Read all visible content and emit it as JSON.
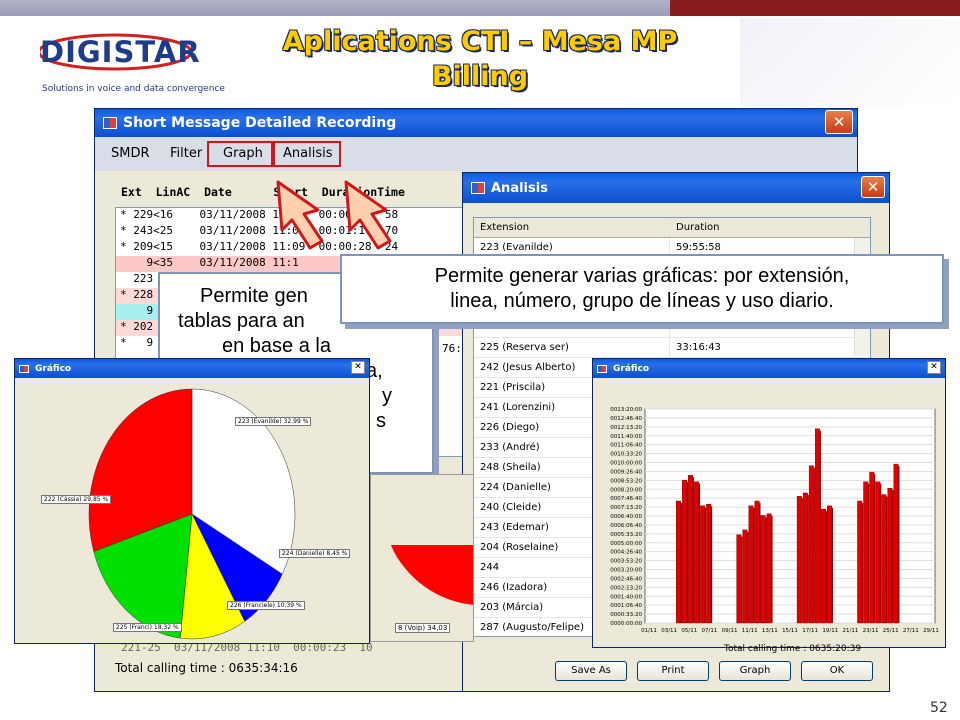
{
  "slide": {
    "title_line1": "Aplications CTI – Mesa MP",
    "title_line2": "Billing",
    "page_number": "52",
    "logo_text": "DIGISTAR",
    "logo_tagline": "Solutions in voice and data convergence"
  },
  "smdr_window": {
    "title": "Short Message Detailed Recording",
    "menu": [
      "SMDR",
      "Filter",
      "Graph",
      "Analisis"
    ],
    "header": "Ext  LinAC  Date      Start  DurationTime",
    "rows": [
      "* 229<16    03/11/2008 11:09  00:00:20  58",
      "* 243<25    03/11/2008 11:09  00:01:17  70",
      "* 209<15    03/11/2008 11:09  00:00:28  24",
      "    9<35    03/11/2008 11:1",
      "  223",
      "* 228",
      "    9",
      "* 202",
      "*   9"
    ],
    "footer_row": "221-25  03/11/2008 11:10  00:00:23  10",
    "total": "Total calling time : 0635:34:16"
  },
  "callout_left": {
    "lines": [
      "Permite gen",
      "tablas para an",
      "en base a la",
      "a,",
      "y",
      "s"
    ],
    "right_tail": "76:"
  },
  "callout_right": {
    "line1": "Permite generar varias gráficas: por extensión,",
    "line2": "linea, número,  grupo de líneas y uso diario."
  },
  "analisis_window": {
    "title": "Analisis",
    "columns": [
      "Extension",
      "Duration"
    ],
    "rows": [
      {
        "ext": "223 (Evanilde)",
        "dur": "59:55:58"
      },
      {
        "ext": "",
        "dur": ""
      },
      {
        "ext": "",
        "dur": ""
      },
      {
        "ext": "",
        "dur": ""
      },
      {
        "ext": "",
        "dur": ""
      },
      {
        "ext": "225 (Reserva ser)",
        "dur": "33:16:43"
      },
      {
        "ext": "242 (Jesus Alberto)",
        "dur": ""
      },
      {
        "ext": "221 (Priscila)",
        "dur": ""
      },
      {
        "ext": "241 (Lorenzini)",
        "dur": ""
      },
      {
        "ext": "226 (Diego)",
        "dur": ""
      },
      {
        "ext": "233 (André)",
        "dur": ""
      },
      {
        "ext": "248 (Sheila)",
        "dur": ""
      },
      {
        "ext": "224 (Danielle)",
        "dur": ""
      },
      {
        "ext": "240 (Cleide)",
        "dur": ""
      },
      {
        "ext": "243 (Edemar)",
        "dur": ""
      },
      {
        "ext": "204 (Roselaine)",
        "dur": ""
      },
      {
        "ext": "244",
        "dur": ""
      },
      {
        "ext": "246 (Izadora)",
        "dur": ""
      },
      {
        "ext": "203 (Márcia)",
        "dur": ""
      },
      {
        "ext": "287 (Augusto/Felipe)",
        "dur": ""
      }
    ],
    "buttons": [
      "Save As",
      "Print",
      "Graph",
      "OK"
    ]
  },
  "pie_window": {
    "title": "Gráfico",
    "labels": [
      "223 (Evanilde) 32,99 %",
      "222 (Cássia) 29,85 %",
      "224 (Danielle) 8,45 %",
      "226 (Franciele) 10,39 %",
      "225 (Franci) 18,32 %"
    ]
  },
  "pie2_label": "8 (Voip) 34,03",
  "bar_window": {
    "title": "Gráfico",
    "total": "Total calling time : 0635:20:39"
  },
  "chart_data": [
    {
      "type": "pie",
      "categories": [
        "223 (Evanilde)",
        "222 (Cássia)",
        "225 (Franci)",
        "226 (Franciele)",
        "224 (Danielle)"
      ],
      "values": [
        32.99,
        29.85,
        18.32,
        10.39,
        8.45
      ],
      "colors": [
        "#ffffff",
        "#ff0000",
        "#00e000",
        "#ffff00",
        "#0000ff"
      ]
    },
    {
      "type": "bar",
      "ytick_labels": [
        "0013:20:00",
        "0012:46:40",
        "0012:13:20",
        "0011:40:00",
        "0011:06:40",
        "0010:33:20",
        "0010:00:00",
        "0009:26:40",
        "0008:53:20",
        "0008:20:00",
        "0007:46:40",
        "0007:13:20",
        "0006:40:00",
        "0006:06:40",
        "0005:33:20",
        "0005:00:00",
        "0004:26:40",
        "0003:53:20",
        "0003:20:00",
        "0002:46:40",
        "0002:13:20",
        "0001:40:00",
        "0001:06:40",
        "0000:33:20",
        "0000:00:00"
      ],
      "xtick_labels": [
        "01/11",
        "03/11",
        "05/11",
        "07/11",
        "09/11",
        "11/11",
        "13/11",
        "15/11",
        "17/11",
        "19/11",
        "21/11",
        "23/11",
        "25/11",
        "27/11",
        "29/11"
      ],
      "ylim_hours": [
        0,
        13.33
      ],
      "values_hours": [
        0,
        0,
        0,
        0,
        0,
        7.6,
        8.9,
        9.2,
        8.8,
        7.3,
        7.4,
        0,
        0,
        0,
        0,
        5.5,
        5.8,
        7.3,
        7.6,
        6.7,
        6.8,
        0,
        0,
        0,
        0,
        7.9,
        8.1,
        9.8,
        12.1,
        7.1,
        7.3,
        0,
        0,
        0,
        0,
        7.6,
        8.8,
        9.4,
        8.8,
        8.0,
        8.4,
        9.9,
        0,
        0,
        0,
        0,
        0,
        0
      ]
    }
  ]
}
